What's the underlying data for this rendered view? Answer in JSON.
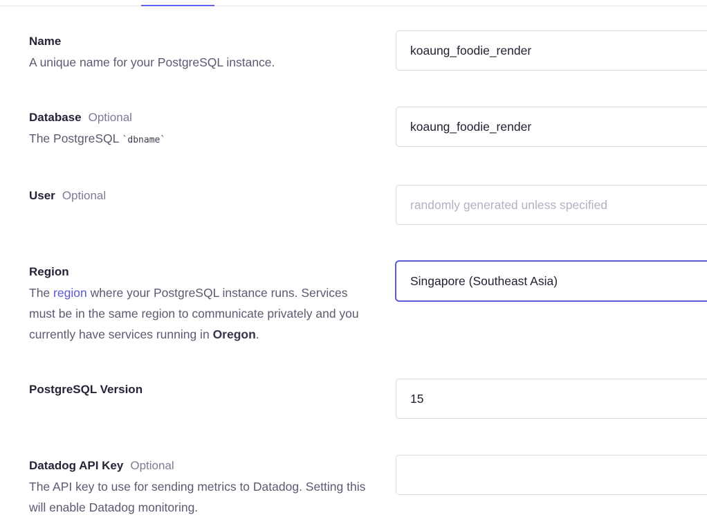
{
  "fields": {
    "name": {
      "label": "Name",
      "description": "A unique name for your PostgreSQL instance.",
      "value": "koaung_foodie_render"
    },
    "database": {
      "label": "Database",
      "optional": "Optional",
      "description_prefix": "The PostgreSQL",
      "description_code": "`dbname`",
      "value": "koaung_foodie_render"
    },
    "user": {
      "label": "User",
      "optional": "Optional",
      "placeholder": "randomly generated unless specified"
    },
    "region": {
      "label": "Region",
      "desc_part1": "The",
      "desc_link": "region",
      "desc_part2": "where your PostgreSQL instance runs. Services must be in the same region to communicate privately and you currently have services running in",
      "desc_bold": "Oregon",
      "desc_end": ".",
      "value": "Singapore (Southeast Asia)"
    },
    "version": {
      "label": "PostgreSQL Version",
      "value": "15"
    },
    "datadog": {
      "label": "Datadog API Key",
      "optional": "Optional",
      "description": "The API key to use for sending metrics to Datadog. Setting this will enable Datadog monitoring.",
      "value": ""
    }
  }
}
